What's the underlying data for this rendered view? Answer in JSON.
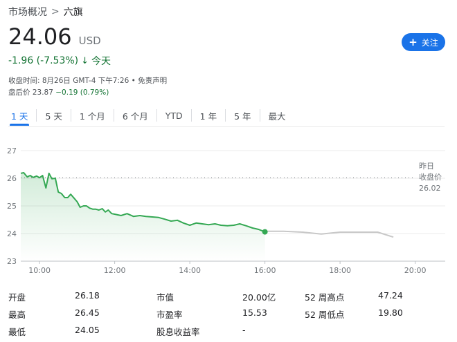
{
  "breadcrumb": {
    "parent": "市场概况",
    "separator": ">",
    "current": "六旗"
  },
  "quote": {
    "price": "24.06",
    "currency": "USD",
    "change": "-1.96 (-7.53%)",
    "direction_arrow": "↓",
    "period": "今天",
    "close_time": "收盘时间: 8月26日 GMT-4 下午7:26 • 免责声明",
    "after_hours_label": "盘后价 23.87",
    "after_hours_change": "−0.19 (0.79%)"
  },
  "follow_button": {
    "icon": "plus-icon",
    "label": "关注"
  },
  "tabs": [
    "1 天",
    "5 天",
    "1 个月",
    "6 个月",
    "YTD",
    "1 年",
    "5 年",
    "最大"
  ],
  "active_tab": 0,
  "colors": {
    "up_green": "#34a853",
    "text_green": "#137333",
    "accent": "#1a73e8",
    "after_hours_gray": "#c8c8c8"
  },
  "chart_data": {
    "type": "line",
    "ylim": [
      23,
      27
    ],
    "yticks": [
      "27",
      "26",
      "25",
      "24",
      "23"
    ],
    "xticks": [
      "10:00",
      "12:00",
      "14:00",
      "16:00",
      "18:00",
      "20:00"
    ],
    "previous_close": {
      "label_line1": "昨日",
      "label_line2": "收盘价",
      "value": "26.02"
    },
    "series": [
      {
        "session": "regular",
        "x_hours": [
          9.5,
          9.58,
          9.67,
          9.75,
          9.83,
          9.92,
          10.0,
          10.08,
          10.17,
          10.25,
          10.33,
          10.42,
          10.5,
          10.58,
          10.67,
          10.75,
          10.83,
          10.92,
          11.0,
          11.08,
          11.17,
          11.25,
          11.33,
          11.42,
          11.5,
          11.58,
          11.67,
          11.75,
          11.83,
          11.92,
          12.0,
          12.17,
          12.33,
          12.5,
          12.67,
          12.83,
          13.0,
          13.17,
          13.33,
          13.5,
          13.67,
          13.83,
          14.0,
          14.17,
          14.33,
          14.5,
          14.67,
          14.83,
          15.0,
          15.17,
          15.33,
          15.5,
          15.67,
          15.83,
          16.0
        ],
        "values": [
          26.18,
          26.2,
          26.05,
          26.1,
          26.03,
          26.08,
          26.02,
          26.1,
          25.65,
          26.18,
          25.98,
          26.0,
          25.5,
          25.45,
          25.3,
          25.3,
          25.42,
          25.28,
          25.15,
          24.95,
          25.0,
          25.0,
          24.92,
          24.88,
          24.88,
          24.85,
          24.9,
          24.78,
          24.85,
          24.72,
          24.7,
          24.65,
          24.72,
          24.62,
          24.65,
          24.62,
          24.6,
          24.58,
          24.52,
          24.45,
          24.48,
          24.38,
          24.3,
          24.38,
          24.35,
          24.32,
          24.35,
          24.3,
          24.28,
          24.3,
          24.35,
          24.28,
          24.2,
          24.15,
          24.06
        ]
      },
      {
        "session": "after_hours",
        "x_hours": [
          16.0,
          16.5,
          17.0,
          17.5,
          18.0,
          18.5,
          19.0,
          19.42
        ],
        "values": [
          24.08,
          24.08,
          24.05,
          23.98,
          24.05,
          24.05,
          24.05,
          23.87
        ]
      }
    ]
  },
  "stats": [
    {
      "label": "开盘",
      "value": "26.18"
    },
    {
      "label": "市值",
      "value": "20.00亿"
    },
    {
      "label": "52 周高点",
      "value": "47.24"
    },
    {
      "label": "最高",
      "value": "26.45"
    },
    {
      "label": "市盈率",
      "value": "15.53"
    },
    {
      "label": "52 周低点",
      "value": "19.80"
    },
    {
      "label": "最低",
      "value": "24.05"
    },
    {
      "label": "股息收益率",
      "value": "-"
    }
  ]
}
